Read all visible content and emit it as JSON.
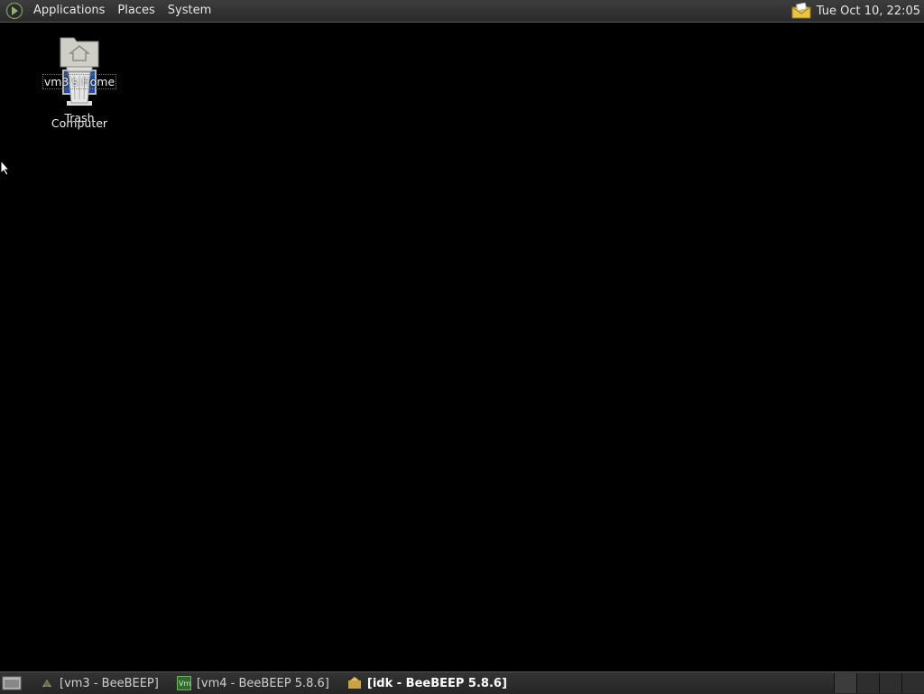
{
  "top_panel": {
    "menus": [
      "Applications",
      "Places",
      "System"
    ],
    "clock": "Tue Oct 10, 22:05"
  },
  "desktop": {
    "icons": {
      "computer": "Computer",
      "home": "vm3's Home",
      "trash": "Trash"
    }
  },
  "taskbar": {
    "tasks": [
      {
        "label": "[vm3 - BeeBEEP]",
        "icon": "beebeep-icon"
      },
      {
        "label": "[vm4 - BeeBEEP 5.8.6]",
        "icon": "vm-icon"
      },
      {
        "label": "[idk - BeeBEEP 5.8.6]",
        "icon": "beebeep-icon",
        "active": true
      }
    ]
  },
  "colors": {
    "desktop_bg": "#000000",
    "panel_bg": "#2f2f2f"
  }
}
